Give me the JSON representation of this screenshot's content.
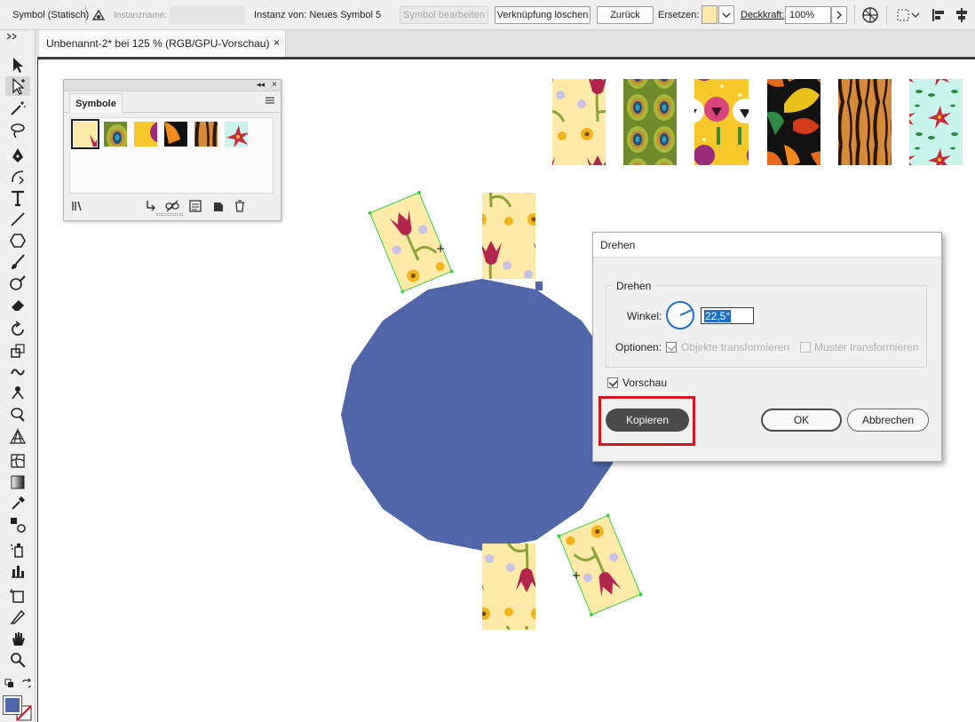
{
  "control_bar": {
    "mode_label": "Symbol (Statisch)",
    "instance_name_label": "Instanzname:",
    "instance_of_label": "Instanz von: Neues Symbol 5",
    "edit_symbol_label": "Symbol bearbeiten",
    "break_link_label": "Verknüpfung löschen",
    "reset_label": "Zurück",
    "replace_label": "Ersetzen:",
    "opacity_label": "Deckkraft:",
    "opacity_value": "100%"
  },
  "document_tab": {
    "title": "Unbenannt-2* bei 125 % (RGB/GPU-Vorschau)",
    "close_glyph": "×"
  },
  "symbols_panel": {
    "title": "Symbole",
    "collapse_glyph": "◂◂",
    "symbols": [
      "Tulpen",
      "Pfauenfedern",
      "Stiefmütterchen",
      "Herbstlaub",
      "Tigerfell",
      "Weihnachtssterne"
    ]
  },
  "rotate_dialog": {
    "title": "Drehen",
    "group_label": "Drehen",
    "angle_label": "Winkel:",
    "angle_value": "22,5°",
    "options_label": "Optionen:",
    "transform_objects_label": "Objekte transformieren",
    "transform_patterns_label": "Muster transformieren",
    "preview_label": "Vorschau",
    "copy_label": "Kopieren",
    "ok_label": "OK",
    "cancel_label": "Abbrechen"
  },
  "colors": {
    "accent": "#1e6fc8",
    "shape_fill": "#5066a8",
    "highlight": "#d6141f",
    "selection": "#39d14a"
  }
}
